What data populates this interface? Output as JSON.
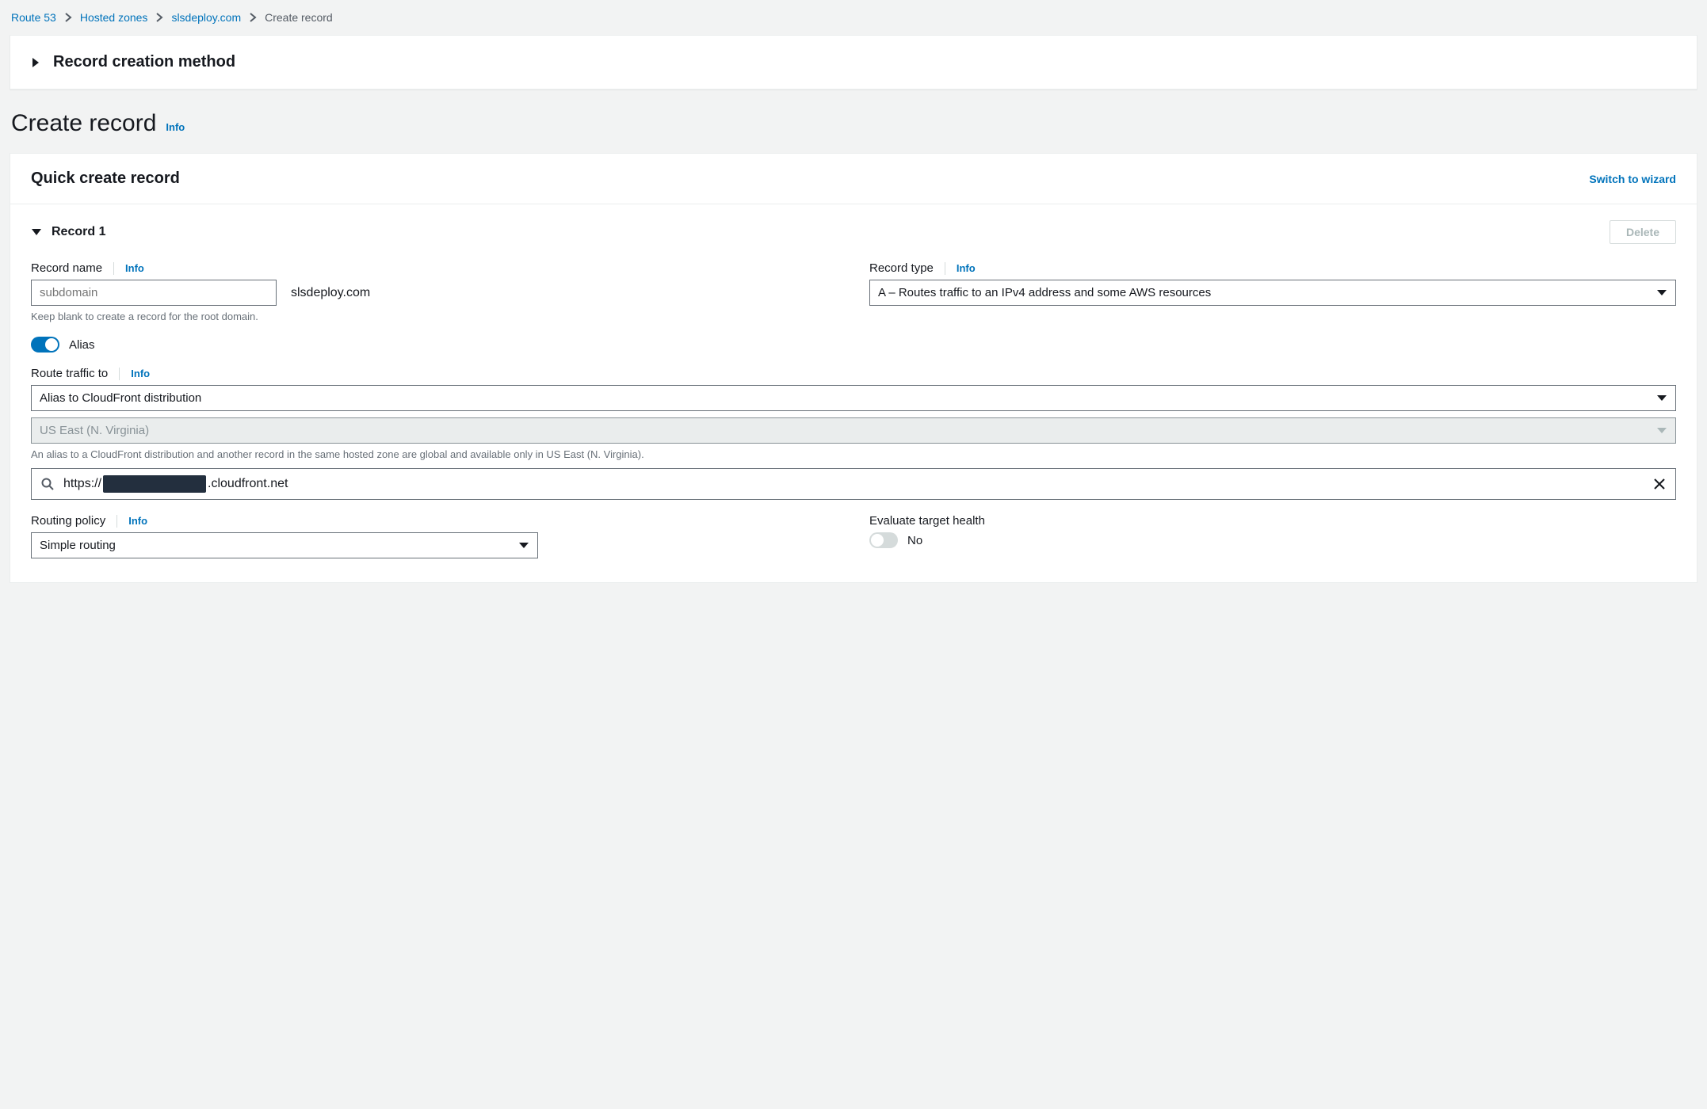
{
  "breadcrumb": {
    "items": [
      {
        "label": "Route 53",
        "link": true
      },
      {
        "label": "Hosted zones",
        "link": true
      },
      {
        "label": "slsdeploy.com",
        "link": true
      },
      {
        "label": "Create record",
        "link": false
      }
    ]
  },
  "method_panel": {
    "title": "Record creation method"
  },
  "page": {
    "title": "Create record",
    "info": "Info"
  },
  "card": {
    "title": "Quick create record",
    "switch_link": "Switch to wizard",
    "record_heading": "Record 1",
    "delete_label": "Delete",
    "record_name": {
      "label": "Record name",
      "info": "Info",
      "placeholder": "subdomain",
      "value": "",
      "suffix": "slsdeploy.com",
      "hint": "Keep blank to create a record for the root domain."
    },
    "record_type": {
      "label": "Record type",
      "info": "Info",
      "selected": "A – Routes traffic to an IPv4 address and some AWS resources"
    },
    "alias": {
      "label": "Alias",
      "on": true
    },
    "route_to": {
      "label": "Route traffic to",
      "info": "Info",
      "alias_target": "Alias to CloudFront distribution",
      "region": "US East (N. Virginia)",
      "hint": "An alias to a CloudFront distribution and another record in the same hosted zone are global and available only in US East (N. Virginia).",
      "search_prefix": "https://",
      "search_suffix": ".cloudfront.net"
    },
    "routing_policy": {
      "label": "Routing policy",
      "info": "Info",
      "selected": "Simple routing"
    },
    "evaluate_health": {
      "label": "Evaluate target health",
      "value_text": "No",
      "on": false
    }
  }
}
